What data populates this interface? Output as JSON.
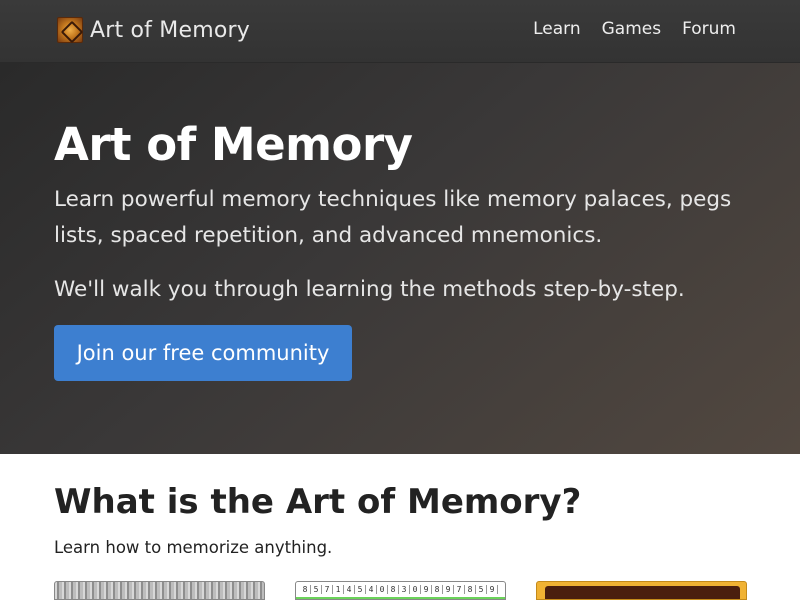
{
  "nav": {
    "brand": "Art of Memory",
    "links": [
      "Learn",
      "Games",
      "Forum"
    ]
  },
  "hero": {
    "title": "Art of Memory",
    "lead": "Learn powerful memory techniques like memory palaces, pegs lists, spaced repetition, and advanced mnemonics.",
    "sub": "We'll walk you through learning the methods step-by-step.",
    "cta": "Join our free community"
  },
  "section": {
    "title": "What is the Art of Memory?",
    "subtitle": "Learn how to memorize anything."
  },
  "cards": {
    "digits": [
      "8",
      "5",
      "7",
      "1",
      "4",
      "5",
      "4",
      "0",
      "8",
      "3",
      "0",
      "9",
      "8",
      "9",
      "7",
      "8",
      "5",
      "9"
    ]
  },
  "colors": {
    "navbar": "#363636",
    "cta": "#3d7fd0",
    "logo": "#c4781e"
  },
  "icons": {
    "brand": "art-of-memory-logo"
  }
}
